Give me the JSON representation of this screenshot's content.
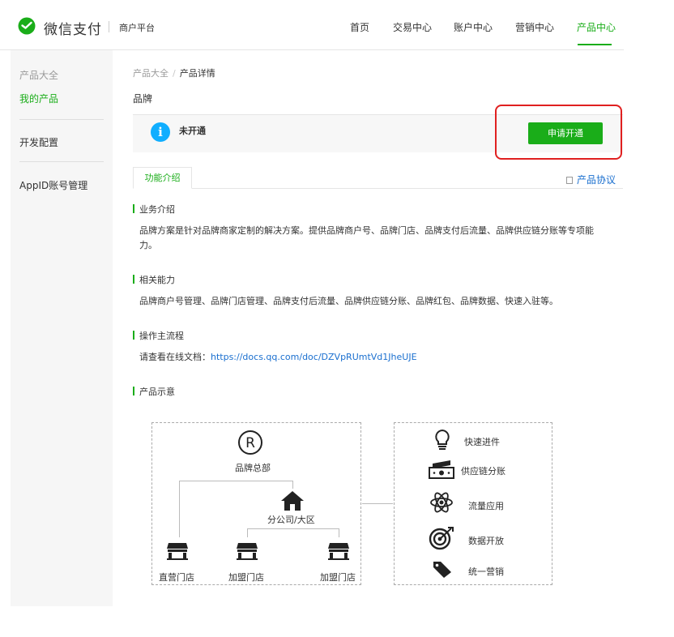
{
  "header": {
    "brand": "微信支付",
    "platform": "商户平台",
    "nav": [
      "首页",
      "交易中心",
      "账户中心",
      "营销中心",
      "产品中心"
    ],
    "active_nav": "产品中心"
  },
  "sidebar": {
    "items": [
      "产品大全",
      "我的产品",
      "开发配置",
      "AppID账号管理"
    ],
    "active": "我的产品"
  },
  "breadcrumb": {
    "parent": "产品大全",
    "separator": "/",
    "current": "产品详情"
  },
  "product": {
    "name": "品牌",
    "status": "未开通",
    "apply_button": "申请开通"
  },
  "tabs": {
    "active": "功能介绍",
    "agreement": "产品协议"
  },
  "sections": {
    "business_title": "业务介绍",
    "business_body": "品牌方案是针对品牌商家定制的解决方案。提供品牌商户号、品牌门店、品牌支付后流量、品牌供应链分账等专项能力。",
    "abilities_title": "相关能力",
    "abilities_body": "品牌商户号管理、品牌门店管理、品牌支付后流量、品牌供应链分账、品牌红包、品牌数据、快速入驻等。",
    "flow_title": "操作主流程",
    "flow_prefix": "请查看在线文档：",
    "flow_link": "https://docs.qq.com/doc/DZVpRUmtVd1JheUJE",
    "diagram_title": "产品示意"
  },
  "diagram": {
    "hq": "品牌总部",
    "branch": "分公司/大区",
    "stores": [
      "直营门店",
      "加盟门店",
      "加盟门店"
    ],
    "features": [
      "快速进件",
      "供应链分账",
      "流量应用",
      "数据开放",
      "统一营销"
    ]
  },
  "colors": {
    "accent": "#1aad19",
    "info": "#10aeff",
    "highlight": "#e02020",
    "link": "#1a6fcf"
  }
}
